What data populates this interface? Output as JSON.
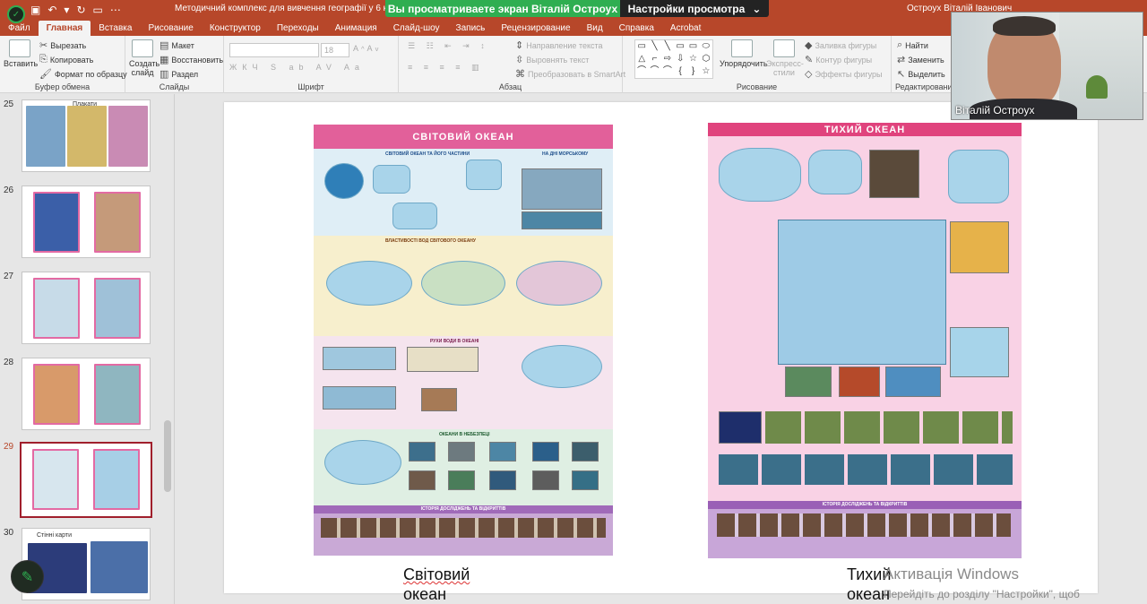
{
  "titlebar": {
    "doc_title": "Методичний комплекс для вивчення географії у 6 кл - PowerP",
    "user_name": "Остроух Віталій Іванович",
    "share_banner_text": "Вы просматриваете экран Віталій Остроух",
    "view_options_label": "Настройки просмотра",
    "view_options_icon": "chevron-down-icon",
    "accent_color": "#b7472a",
    "banner_color": "#2fae51"
  },
  "menu": {
    "tabs": [
      "Файл",
      "Главная",
      "Вставка",
      "Рисование",
      "Конструктор",
      "Переходы",
      "Анимация",
      "Слайд-шоу",
      "Запись",
      "Рецензирование",
      "Вид",
      "Справка",
      "Acrobat"
    ],
    "active": "Главная"
  },
  "ribbon": {
    "clipboard": {
      "label": "Буфер обмена",
      "paste": "Вставить",
      "cut": "Вырезать",
      "copy": "Копировать",
      "format_painter": "Формат по образцу"
    },
    "slides": {
      "label": "Слайды",
      "new_slide": "Создать слайд",
      "layout": "Макет",
      "reset": "Восстановить",
      "section": "Раздел"
    },
    "font": {
      "label": "Шрифт",
      "size": "18"
    },
    "paragraph": {
      "label": "Абзац",
      "text_direction": "Направление текста",
      "align_text": "Выровнять текст",
      "smartart": "Преобразовать в SmartArt"
    },
    "drawing": {
      "label": "Рисование",
      "arrange": "Упорядочить",
      "quick_styles": "Экспресс-стили",
      "shape_fill": "Заливка фигуры",
      "shape_outline": "Контур фигуры",
      "shape_effects": "Эффекты фигуры"
    },
    "editing": {
      "label": "Редактирование",
      "find": "Найти",
      "replace": "Заменить",
      "select": "Выделить"
    }
  },
  "slides_panel": {
    "items": [
      {
        "number": "25",
        "caption": "Плакати"
      },
      {
        "number": "26",
        "caption": ""
      },
      {
        "number": "27",
        "caption": ""
      },
      {
        "number": "28",
        "caption": ""
      },
      {
        "number": "29",
        "caption": ""
      },
      {
        "number": "30",
        "caption": "Стінні карти"
      }
    ],
    "selected": "29"
  },
  "slide": {
    "poster_left": {
      "title": "СВІТОВИЙ ОКЕАН",
      "section1": "СВІТОВИЙ ОКЕАН ТА ЙОГО ЧАСТИНИ",
      "section1b": "НА ДНІ МОРСЬКОМУ",
      "section2": "ВЛАСТИВОСТІ ВОД СВІТОВОГО ОКЕАНУ",
      "section3": "РУХИ ВОДИ В ОКЕАНІ",
      "section4": "ОКЕАНИ В НЕБЕЗПЕЦІ",
      "section5": "ІСТОРІЯ ДОСЛІДЖЕНЬ ТА ВІДКРИТТІВ"
    },
    "poster_right": {
      "title": "ТИХИЙ ОКЕАН",
      "section5": "ІСТОРІЯ ДОСЛІДЖЕНЬ ТА ВІДКРИТТІВ"
    },
    "caption_left": [
      "Світовий",
      "океан"
    ],
    "caption_right": [
      "Тихий",
      "океан"
    ]
  },
  "watermark": {
    "line1": "Активація Windows",
    "line2": "Перейдіть до розділу \"Настройки\", щоб"
  },
  "webcam": {
    "name": "Віталій Остроух"
  }
}
